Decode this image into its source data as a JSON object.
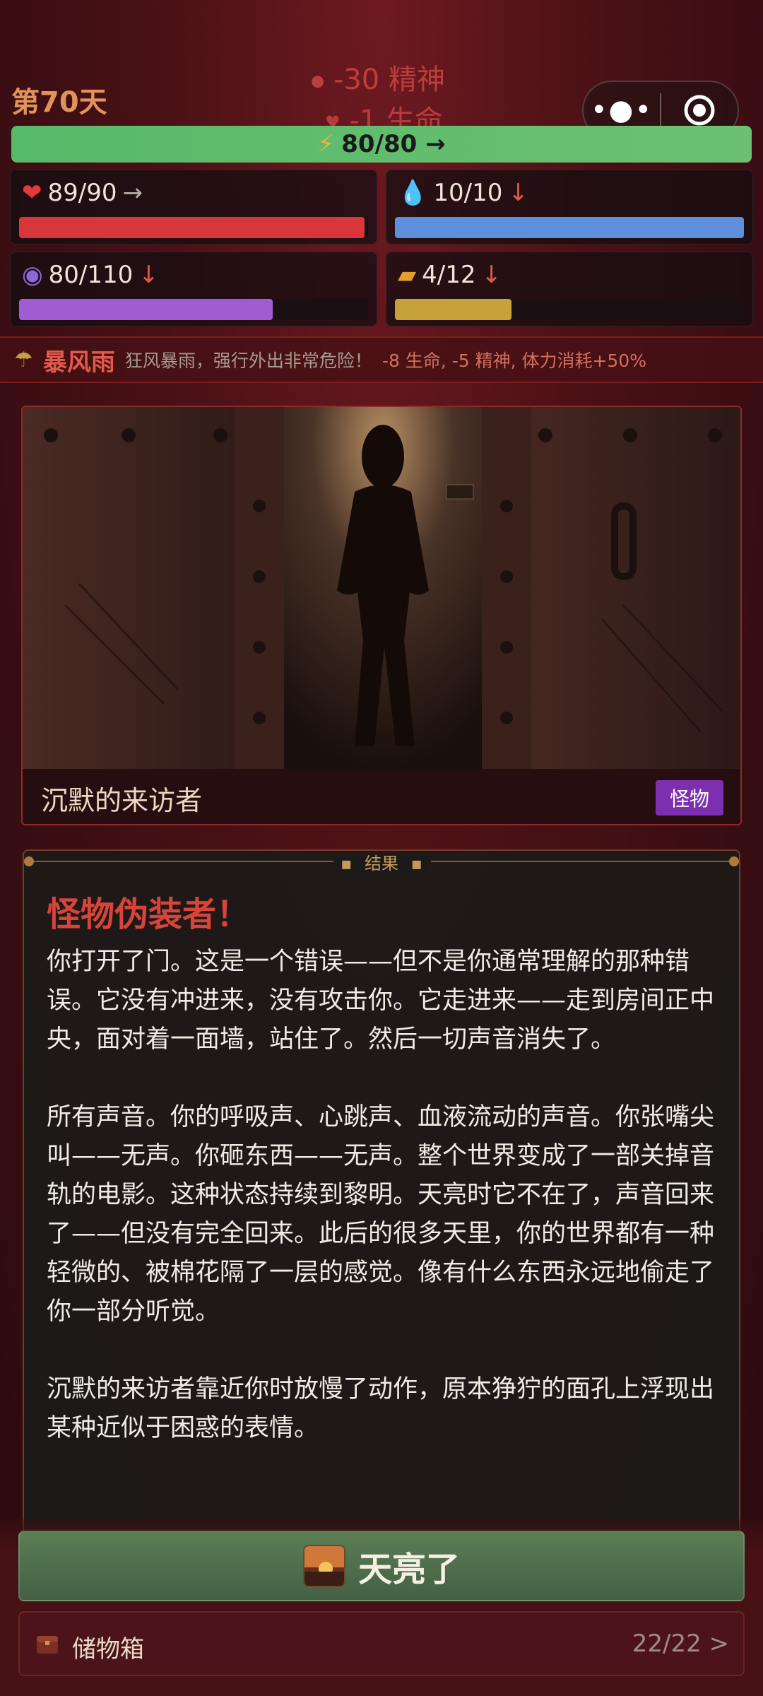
{
  "header": {
    "day_label": "第70天",
    "float_mind": "-30 精神",
    "float_life": "-1 生命",
    "stamina": "80/80 →"
  },
  "stats": [
    {
      "name": "health",
      "value": "89/90",
      "trend": "→",
      "fill": 0.989,
      "color": "#d7363b"
    },
    {
      "name": "water",
      "value": "10/10",
      "trend": "↓",
      "fill": 1.0,
      "color": "#5e8fdc"
    },
    {
      "name": "mind",
      "value": "80/110",
      "trend": "↓",
      "fill": 0.727,
      "color": "#a05cd2"
    },
    {
      "name": "food",
      "value": "4/12",
      "trend": "↓",
      "fill": 0.333,
      "color": "#c7a23a"
    }
  ],
  "weather": {
    "name": "暴风雨",
    "desc": "狂风暴雨，强行外出非常危险！",
    "effect": "-8 生命, -5 精神, 体力消耗+50%"
  },
  "event": {
    "title": "沉默的来访者",
    "tag": "怪物"
  },
  "result": {
    "label": "结果",
    "title": "怪物伪装者！",
    "body": "你打开了门。这是一个错误——但不是你通常理解的那种错误。它没有冲进来，没有攻击你。它走进来——走到房间正中央，面对着一面墙，站住了。然后一切声音消失了。\n\n所有声音。你的呼吸声、心跳声、血液流动的声音。你张嘴尖叫——无声。你砸东西——无声。整个世界变成了一部关掉音轨的电影。这种状态持续到黎明。天亮时它不在了，声音回来了——但没有完全回来。此后的很多天里，你的世界都有一种轻微的、被棉花隔了一层的感觉。像有什么东西永远地偷走了你一部分听觉。\n\n沉默的来访者靠近你时放慢了动作，原本狰狞的面孔上浮现出某种近似于困惑的表情。"
  },
  "actions": {
    "dawn_label": "天亮了",
    "storage_label": "储物箱",
    "storage_count": "22/22 >"
  }
}
